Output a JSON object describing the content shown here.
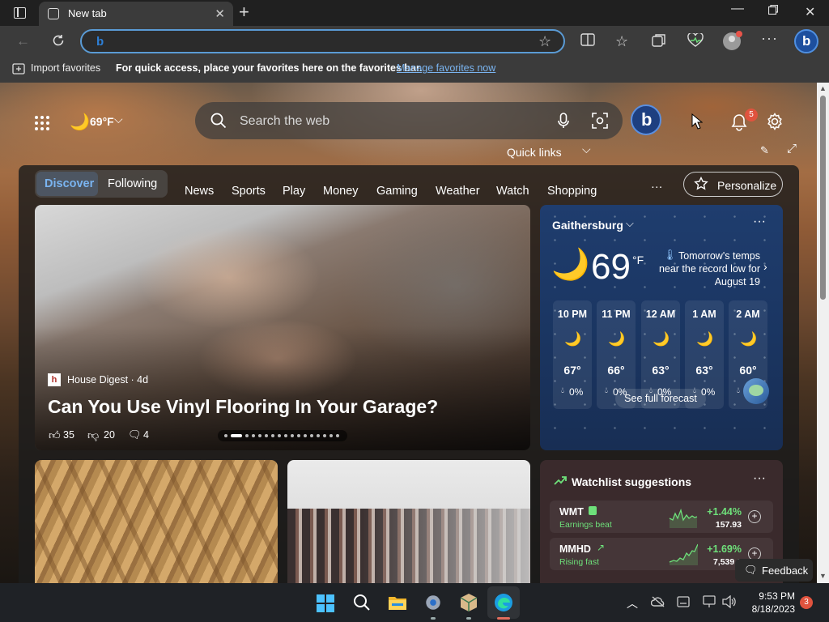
{
  "tab": {
    "title": "New tab"
  },
  "favorites": {
    "import_label": "Import favorites",
    "hint": "For quick access, place your favorites here on the favorites bar.",
    "manage_link": "Manage favorites now"
  },
  "header": {
    "temp": "69°F",
    "search_placeholder": "Search the web",
    "quick_links": "Quick links",
    "notification_count": "5"
  },
  "nav": {
    "discover": "Discover",
    "following": "Following",
    "items": [
      "News",
      "Sports",
      "Play",
      "Money",
      "Gaming",
      "Weather",
      "Watch",
      "Shopping"
    ],
    "more": "···",
    "personalize": "Personalize"
  },
  "hero": {
    "source": "House Digest · 4d",
    "title": "Can You Use Vinyl Flooring In Your Garage?",
    "likes": "35",
    "dislikes": "20",
    "comments": "4"
  },
  "weather": {
    "location": "Gaithersburg",
    "temp": "69",
    "unit": "°F",
    "alert": [
      "Tomorrow's temps",
      "near the record low for",
      "August 19"
    ],
    "hours": [
      {
        "time": "10 PM",
        "temp": "67°",
        "precip": "0%"
      },
      {
        "time": "11 PM",
        "temp": "66°",
        "precip": "0%"
      },
      {
        "time": "12 AM",
        "temp": "63°",
        "precip": "0%"
      },
      {
        "time": "1 AM",
        "temp": "63°",
        "precip": "0%"
      },
      {
        "time": "2 AM",
        "temp": "60°",
        "precip": "0%"
      }
    ],
    "forecast_button": "See full forecast"
  },
  "watchlist": {
    "title": "Watchlist suggestions",
    "items": [
      {
        "symbol": "WMT",
        "note": "Earnings beat",
        "change": "+1.44%",
        "price": "157.93"
      },
      {
        "symbol": "MMHD",
        "note": "Rising fast",
        "change": "+1.69%",
        "price": "7,539.0"
      }
    ]
  },
  "feedback": "Feedback",
  "taskbar": {
    "time": "9:53 PM",
    "date": "8/18/2023",
    "badge": "3"
  },
  "colors": {
    "accent": "#5a9bd5",
    "link": "#7ab4f0",
    "positive": "#6ee07a",
    "badge": "#e0533e"
  }
}
